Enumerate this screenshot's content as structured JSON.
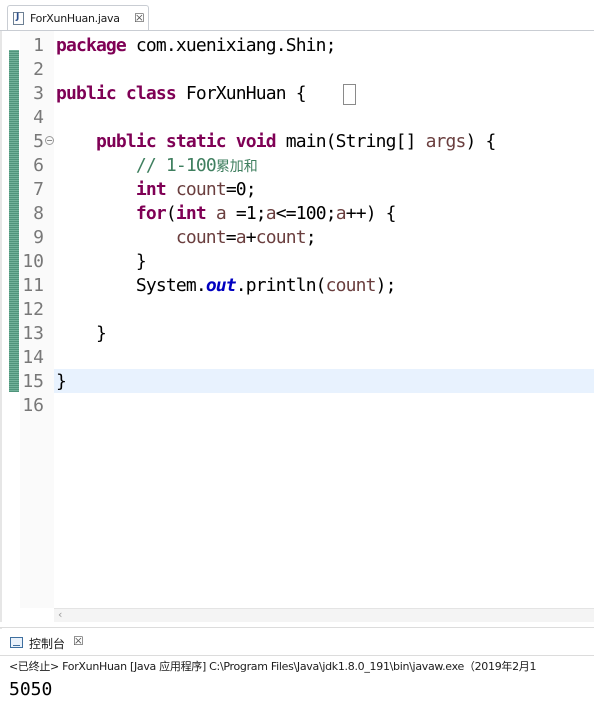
{
  "editor_tab": {
    "file_name": "ForXunHuan.java",
    "file_icon": "java-file-icon",
    "close_symbol": "☒"
  },
  "editor": {
    "code_lines": [
      {
        "num": "1",
        "segs": [
          [
            "kw",
            "package"
          ],
          [
            "",
            " com.xuenixiang.Shin;"
          ]
        ]
      },
      {
        "num": "2",
        "segs": []
      },
      {
        "num": "3",
        "segs": [
          [
            "kw",
            "public"
          ],
          [
            "",
            " "
          ],
          [
            "kw",
            "class"
          ],
          [
            "",
            " ForXunHuan {"
          ]
        ]
      },
      {
        "num": "4",
        "segs": []
      },
      {
        "num": "5",
        "fold": true,
        "segs": [
          [
            "",
            "    "
          ],
          [
            "kw",
            "public"
          ],
          [
            "",
            " "
          ],
          [
            "kw",
            "static"
          ],
          [
            "",
            " "
          ],
          [
            "kw",
            "void"
          ],
          [
            "",
            " main(String[] "
          ],
          [
            "vr",
            "args"
          ],
          [
            "",
            ") {"
          ]
        ]
      },
      {
        "num": "6",
        "segs": [
          [
            "",
            "        "
          ],
          [
            "cm",
            "// 1-100"
          ],
          [
            "cm cjk",
            "累加和"
          ]
        ]
      },
      {
        "num": "7",
        "segs": [
          [
            "",
            "        "
          ],
          [
            "kw",
            "int"
          ],
          [
            "",
            " "
          ],
          [
            "vr",
            "count"
          ],
          [
            "",
            "=0;"
          ]
        ]
      },
      {
        "num": "8",
        "segs": [
          [
            "",
            "        "
          ],
          [
            "kw",
            "for"
          ],
          [
            "",
            "("
          ],
          [
            "kw",
            "int"
          ],
          [
            "",
            " "
          ],
          [
            "vr",
            "a"
          ],
          [
            "",
            " =1;"
          ],
          [
            "vr",
            "a"
          ],
          [
            "",
            "<=100;"
          ],
          [
            "vr",
            "a"
          ],
          [
            "",
            "++) {"
          ]
        ]
      },
      {
        "num": "9",
        "segs": [
          [
            "",
            "            "
          ],
          [
            "vr",
            "count"
          ],
          [
            "",
            "="
          ],
          [
            "vr",
            "a"
          ],
          [
            "",
            "+"
          ],
          [
            "vr",
            "count"
          ],
          [
            "",
            ";"
          ]
        ]
      },
      {
        "num": "10",
        "segs": [
          [
            "",
            "        }"
          ]
        ]
      },
      {
        "num": "11",
        "segs": [
          [
            "",
            "        System."
          ],
          [
            "fld",
            "out"
          ],
          [
            "",
            ".println("
          ],
          [
            "vr",
            "count"
          ],
          [
            "",
            ");"
          ]
        ]
      },
      {
        "num": "12",
        "segs": []
      },
      {
        "num": "13",
        "segs": [
          [
            "",
            "    }"
          ]
        ]
      },
      {
        "num": "14",
        "segs": []
      },
      {
        "num": "15",
        "segs": [
          [
            "",
            "}"
          ]
        ]
      },
      {
        "num": "16",
        "segs": []
      }
    ],
    "scroll_left_symbol": "‹"
  },
  "console": {
    "tab_label": "控制台",
    "close_symbol": "☒",
    "status": "<已终止> ForXunHuan [Java 应用程序] C:\\Program Files\\Java\\jdk1.8.0_191\\bin\\javaw.exe（2019年2月1",
    "output": "5050"
  },
  "colors": {
    "keyword": "#7f0055",
    "comment": "#3f7f5f",
    "local_variable": "#6a3e3e",
    "static_field": "#0000c0",
    "current_line": "#e8f2fe",
    "change_ruler": "#5a9e86"
  }
}
